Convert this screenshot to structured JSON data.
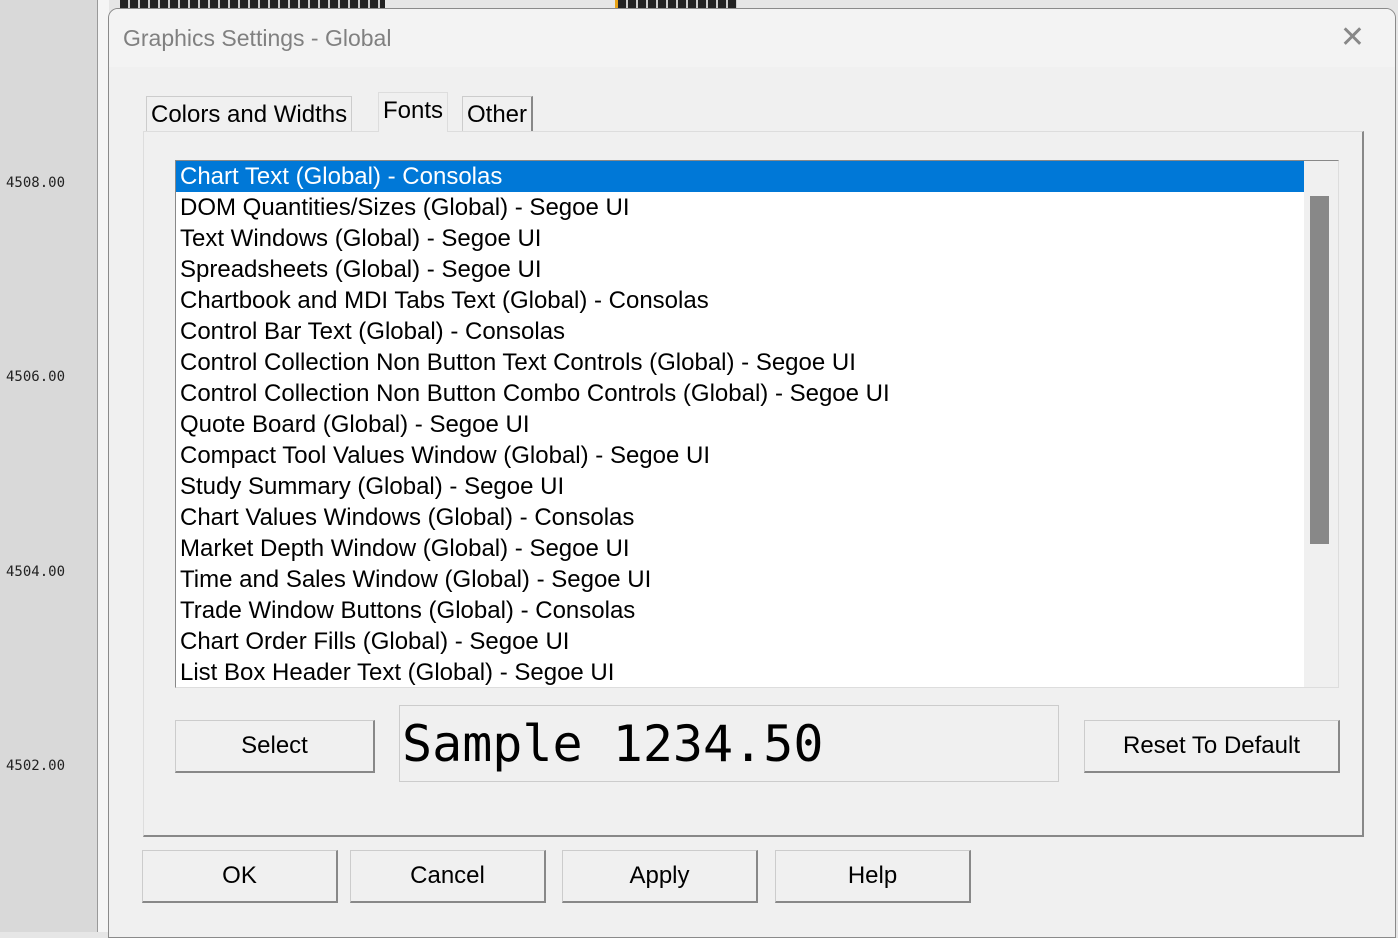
{
  "chart": {
    "prices": [
      "4508.00",
      "4506.00",
      "4504.00",
      "4502.00"
    ]
  },
  "dialog": {
    "title": "Graphics Settings - Global",
    "tabs": [
      "Colors and Widths",
      "Fonts",
      "Other"
    ],
    "active_tab": "Fonts",
    "fonts": [
      "Chart Text (Global) - Consolas",
      "DOM Quantities/Sizes (Global) - Segoe UI",
      "Text Windows (Global) - Segoe UI",
      "Spreadsheets (Global) - Segoe UI",
      "Chartbook and MDI Tabs Text (Global) - Consolas",
      "Control Bar Text (Global) - Consolas",
      "Control Collection Non Button Text Controls (Global) - Segoe UI",
      "Control Collection Non Button Combo Controls (Global) - Segoe UI",
      "Quote Board (Global) - Segoe UI",
      "Compact Tool Values Window (Global) - Segoe UI",
      "Study Summary (Global) - Segoe UI",
      "Chart Values Windows (Global) - Consolas",
      "Market Depth Window (Global) - Segoe UI",
      "Time and Sales Window (Global) - Segoe UI",
      "Trade Window Buttons (Global) - Consolas",
      "Chart Order Fills (Global) - Segoe UI",
      "List Box Header Text (Global) - Segoe UI"
    ],
    "select_label": "Select",
    "sample_text": "Sample 1234.50",
    "reset_label": "Reset To Default",
    "ok_label": "OK",
    "cancel_label": "Cancel",
    "apply_label": "Apply",
    "help_label": "Help",
    "accent": "#0078d7"
  }
}
